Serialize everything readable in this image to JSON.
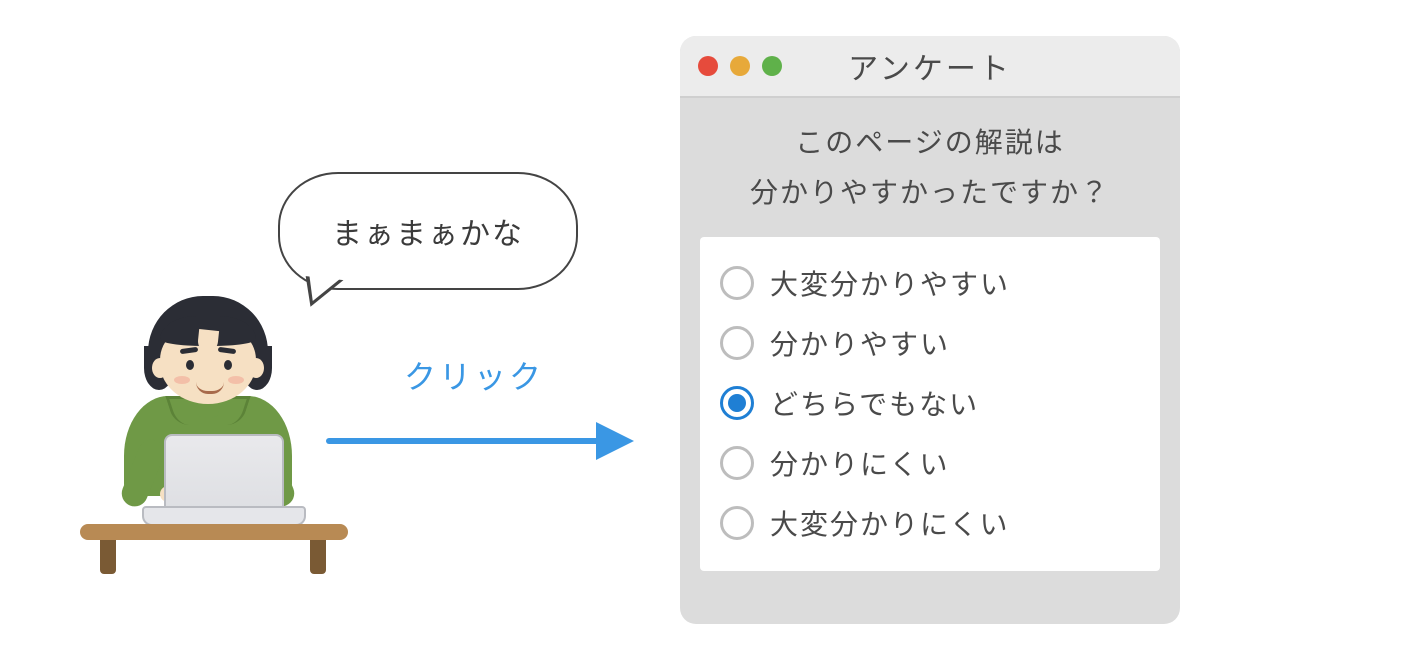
{
  "bubble_text": "まぁまぁかな",
  "arrow_label": "クリック",
  "window": {
    "title": "アンケート",
    "question_line1": "このページの解説は",
    "question_line2": "分かりやすかったですか？",
    "options": [
      "大変分かりやすい",
      "分かりやすい",
      "どちらでもない",
      "分かりにくい",
      "大変分かりにくい"
    ],
    "selected_index": 2
  }
}
